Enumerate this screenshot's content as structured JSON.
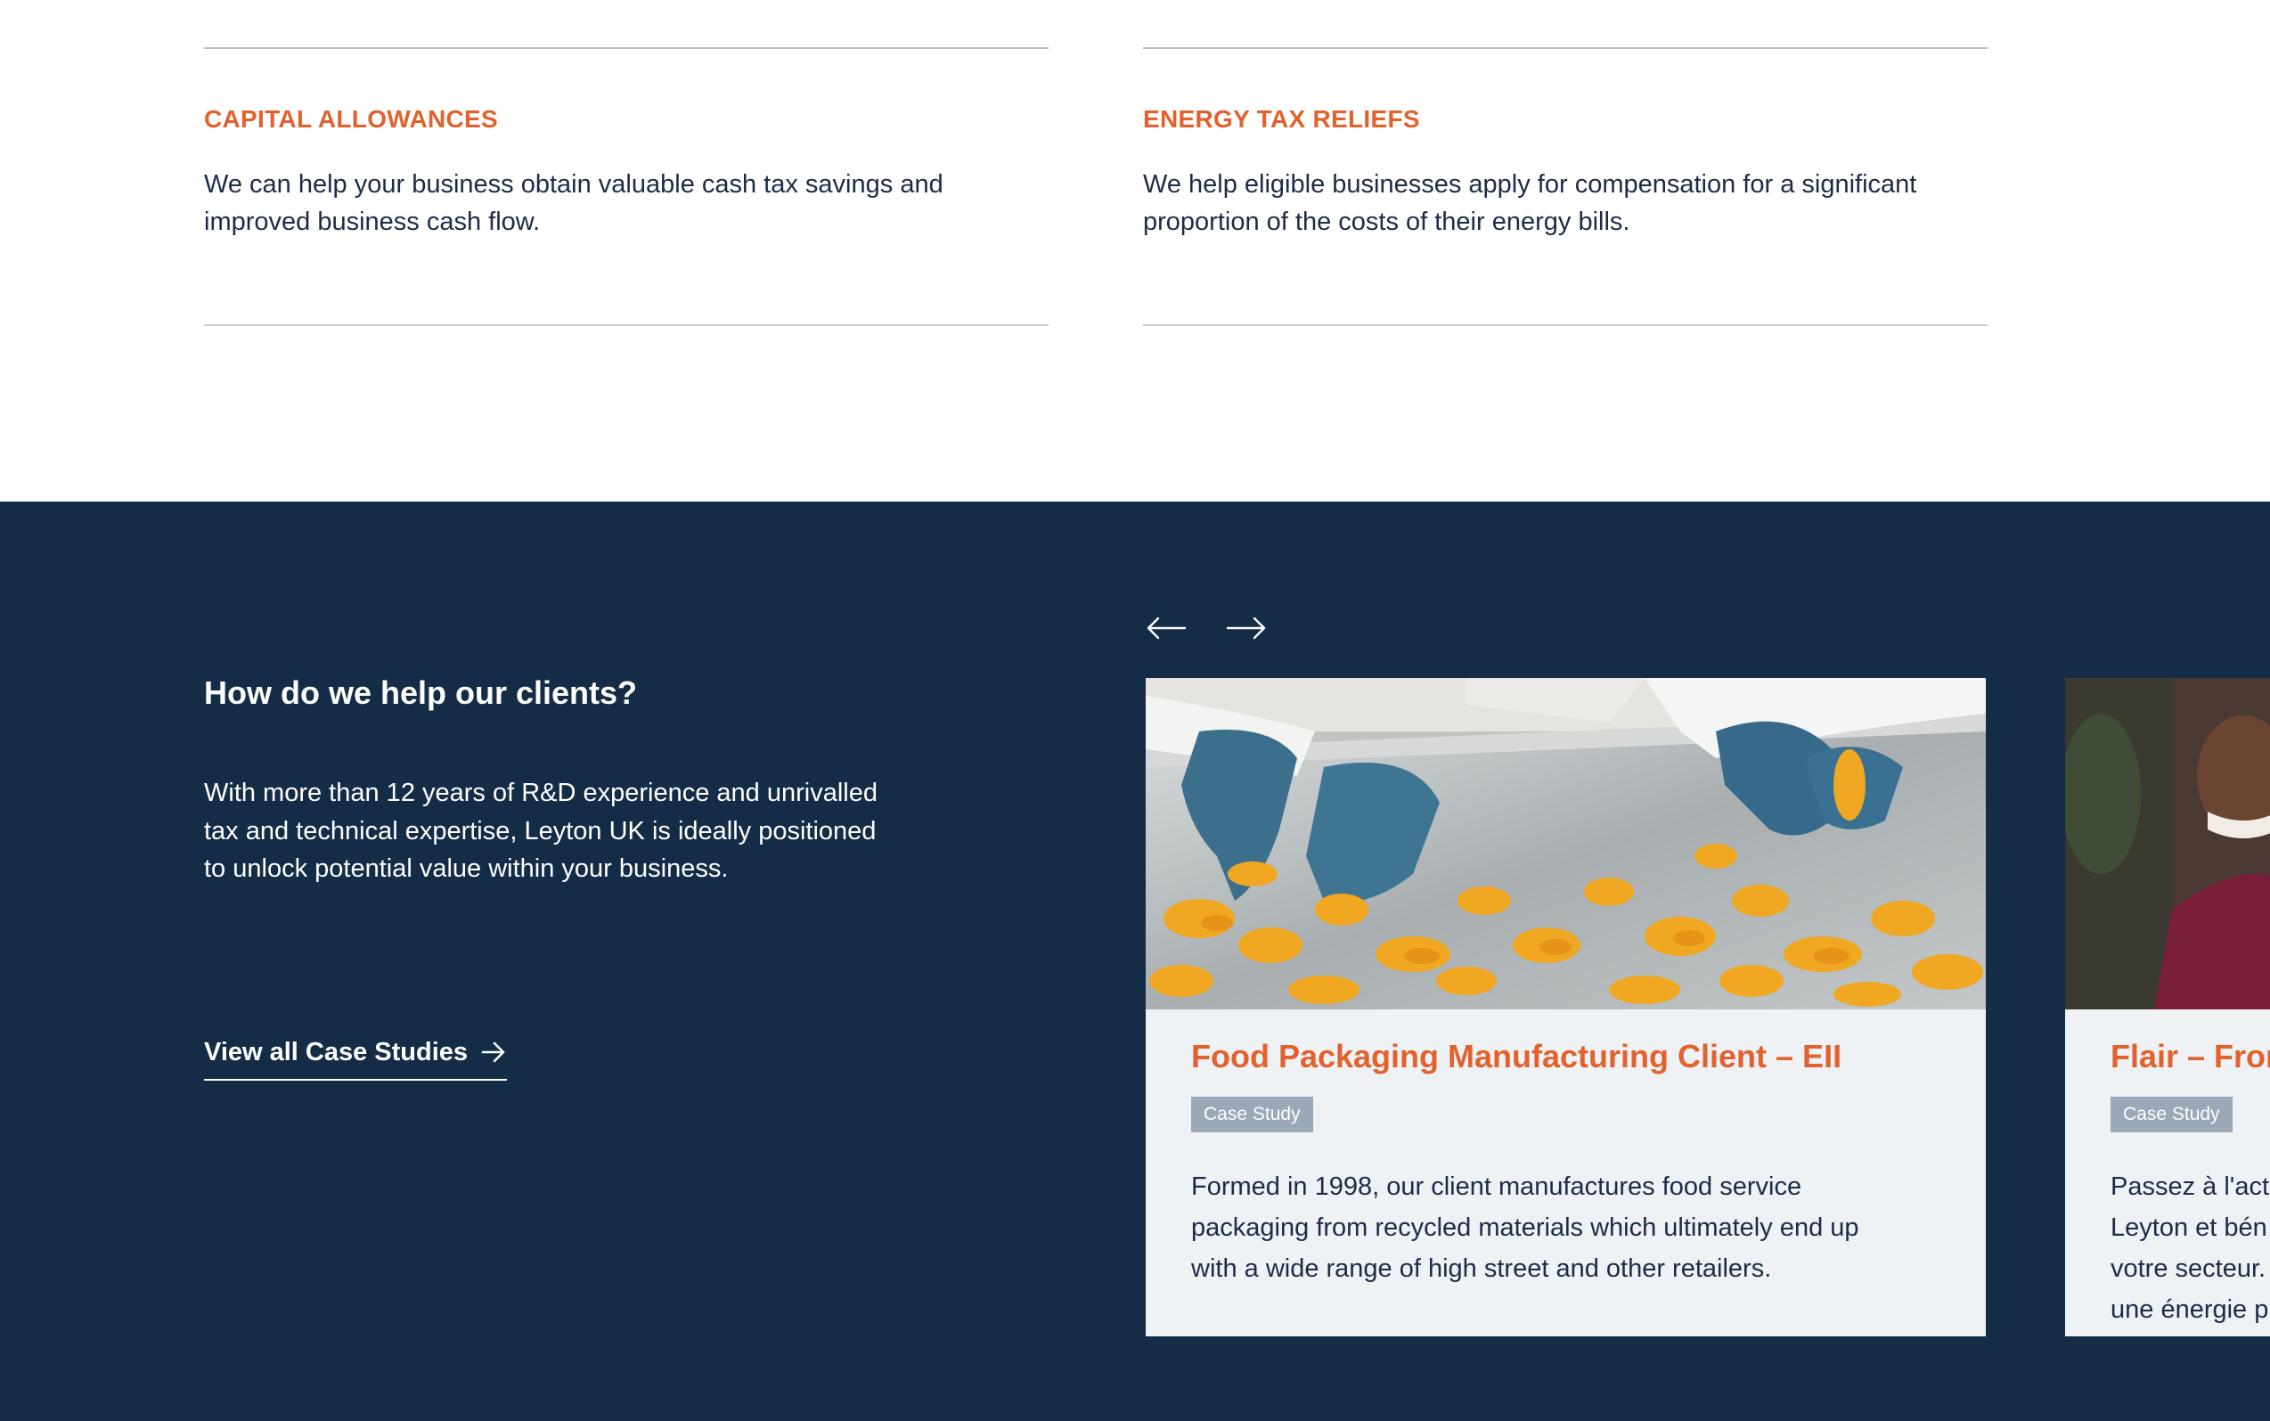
{
  "services": [
    {
      "title": "CAPITAL ALLOWANCES",
      "description": "We can help your business obtain valuable cash tax savings and improved business cash flow."
    },
    {
      "title": "ENERGY TAX RELIEFS",
      "description": "We help eligible businesses apply for compensation for a significant proportion of the costs of their energy bills."
    }
  ],
  "case_section": {
    "heading": "How do we help our clients?",
    "body": "With more than 12 years of R&D experience and unrivalled tax and technical expertise, Leyton UK is ideally positioned to unlock potential value within your business.",
    "view_all_label": "View all Case Studies",
    "prev_icon": "arrow-left-icon",
    "next_icon": "arrow-right-icon",
    "cards": [
      {
        "title": "Food Packaging Manufacturing Client – EII",
        "badge": "Case Study",
        "description": "Formed in 1998, our client manufactures food service packaging from recycled materials which ultimately end up with a wide range of high street and other retailers.",
        "image": "gloved-hands-sorting-food-photo"
      },
      {
        "title": "Flair – Fron",
        "badge": "Case Study",
        "description_lines": [
          "Passez à l'acti",
          "Leyton et bén",
          "votre secteur.",
          "une énergie p"
        ],
        "image": "smiling-man-portrait-photo"
      }
    ]
  },
  "colors": {
    "accent_orange": "#e2612d",
    "navy": "#142c45",
    "card_bg": "#eef2f5",
    "badge_bg": "#9aa8b7"
  }
}
